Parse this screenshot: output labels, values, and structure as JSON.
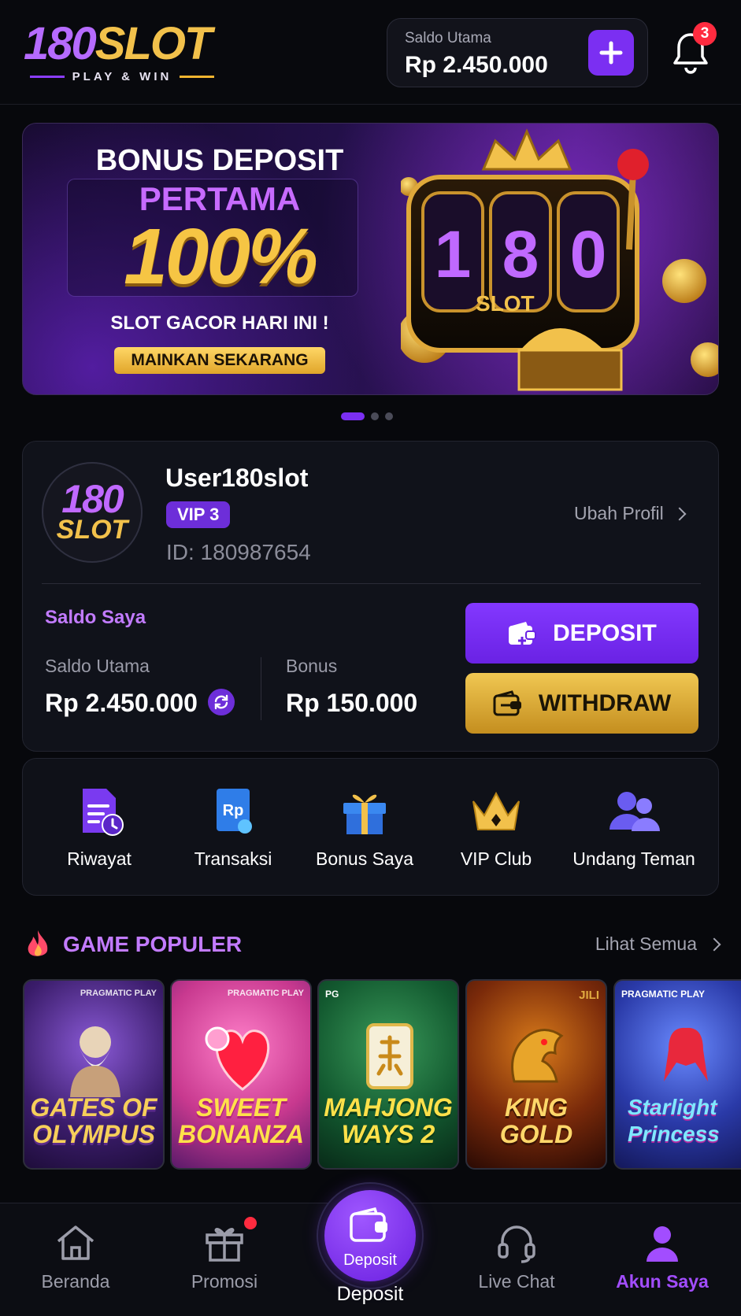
{
  "header": {
    "logo_main_num": "180",
    "logo_main_word": "SLOT",
    "logo_tagline": "PLAY & WIN",
    "balance_label": "Saldo Utama",
    "balance_value": "Rp 2.450.000",
    "add_icon": "plus-icon",
    "notification_icon": "bell-icon",
    "notification_count": "3"
  },
  "banner": {
    "title": "BONUS DEPOSIT",
    "subtitle": "PERTAMA",
    "percent": "100%",
    "tagline": "SLOT GACOR HARI INI !",
    "cta": "MAINKAN SEKARANG",
    "reel_text": "180",
    "machine_label": "SLOT",
    "dots_count": 3,
    "active_dot": 0
  },
  "profile": {
    "avatar_num": "180",
    "avatar_word": "SLOT",
    "username": "User180slot",
    "vip": "VIP 3",
    "user_id": "ID: 180987654",
    "edit_label": "Ubah Profil",
    "saldo_title": "Saldo Saya",
    "main_label": "Saldo Utama",
    "main_value": "Rp 2.450.000",
    "bonus_label": "Bonus",
    "bonus_value": "Rp 150.000",
    "deposit_btn": "DEPOSIT",
    "withdraw_btn": "WITHDRAW"
  },
  "quick_menu": [
    {
      "label": "Riwayat",
      "icon": "history-icon"
    },
    {
      "label": "Transaksi",
      "icon": "transaction-icon"
    },
    {
      "label": "Bonus Saya",
      "icon": "gift-icon"
    },
    {
      "label": "VIP Club",
      "icon": "crown-icon"
    },
    {
      "label": "Undang Teman",
      "icon": "invite-friends-icon"
    }
  ],
  "games_section": {
    "title": "GAME POPULER",
    "see_all": "Lihat Semua",
    "games": [
      {
        "name": "GATES OF OLYMPUS",
        "provider": "PRAGMATIC PLAY"
      },
      {
        "name": "SWEET BONANZA",
        "provider": "PRAGMATIC PLAY"
      },
      {
        "name": "MAHJONG WAYS 2",
        "provider": "PG"
      },
      {
        "name": "KING GOLD",
        "provider": "JILI"
      },
      {
        "name": "Starlight Princess",
        "provider": "PRAGMATIC PLAY"
      }
    ]
  },
  "bottom_nav": {
    "items": [
      {
        "label": "Beranda",
        "icon": "home-icon"
      },
      {
        "label": "Promosi",
        "icon": "gift-icon"
      },
      {
        "label": "Deposit",
        "icon": "wallet-icon"
      },
      {
        "label": "Live Chat",
        "icon": "headset-icon"
      },
      {
        "label": "Akun Saya",
        "icon": "user-icon"
      }
    ],
    "fab_inner_label": "Deposit",
    "active": "Akun Saya"
  },
  "colors": {
    "accent": "#7b2ff2",
    "gold": "#f2c14b",
    "badge": "#ff2b3f",
    "background": "#07080c"
  }
}
